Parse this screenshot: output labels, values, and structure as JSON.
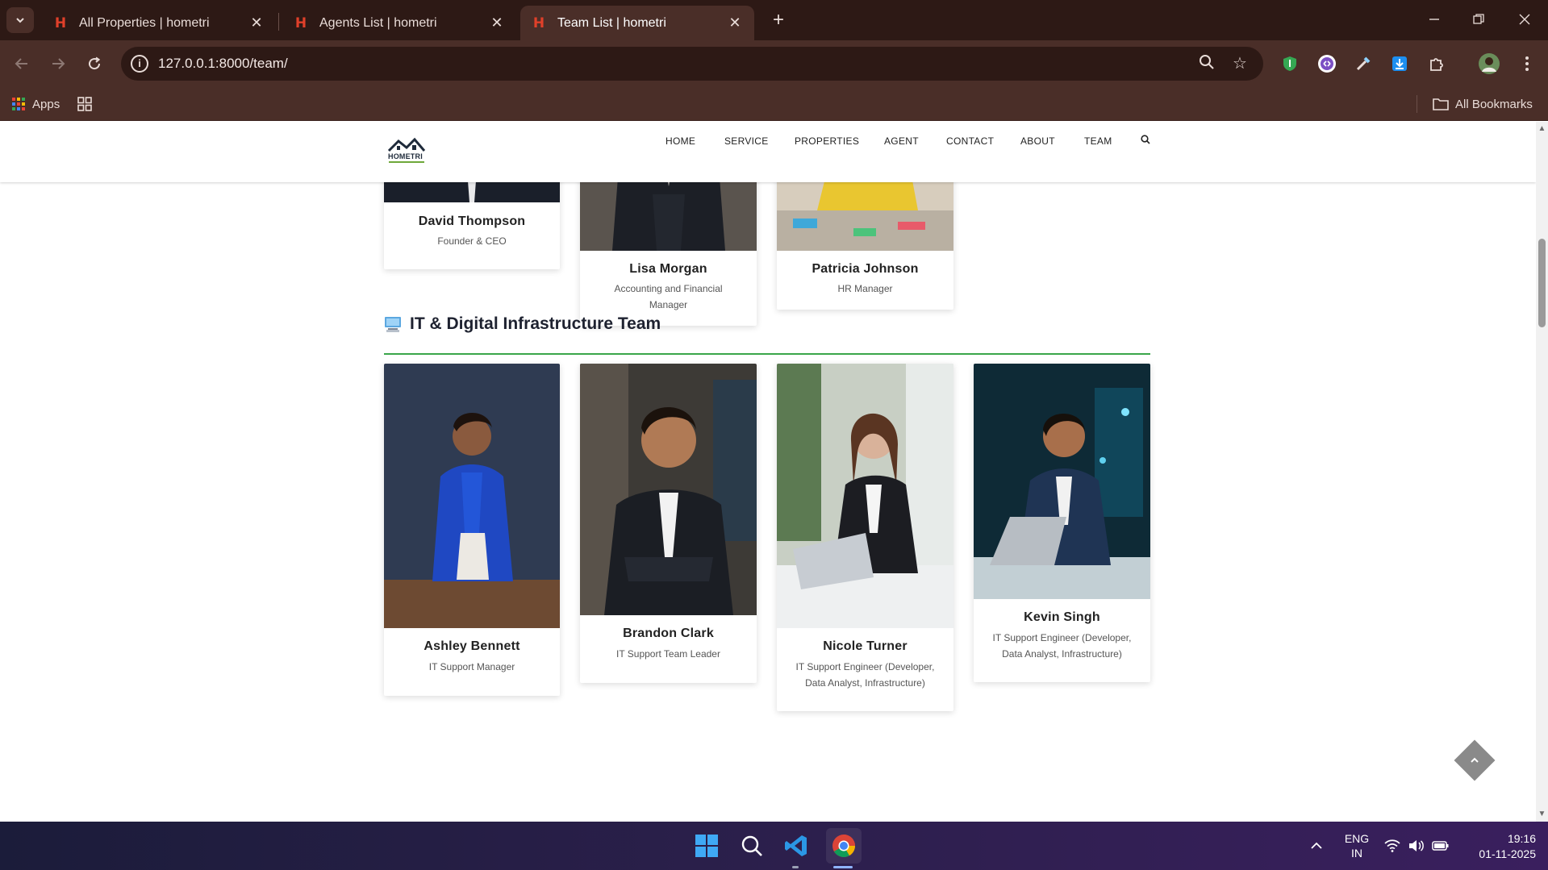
{
  "browser": {
    "tabs": [
      {
        "title": "All Properties | hometri",
        "active": false
      },
      {
        "title": "Agents List | hometri",
        "active": false
      },
      {
        "title": "Team List | hometri",
        "active": true
      }
    ],
    "url": "127.0.0.1:8000/team/",
    "bookmarks": {
      "apps_label": "Apps",
      "all_bookmarks_label": "All Bookmarks"
    }
  },
  "site": {
    "logo_text": "HOMETRI",
    "nav": [
      "HOME",
      "SERVICE",
      "PROPERTIES",
      "AGENT",
      "CONTACT",
      "ABOUT",
      "TEAM"
    ]
  },
  "leadership_row": [
    {
      "name": "David Thompson",
      "role": "Founder & CEO"
    },
    {
      "name": "Lisa Morgan",
      "role": "Accounting and Financial Manager"
    },
    {
      "name": "Patricia Johnson",
      "role": "HR Manager"
    }
  ],
  "it_section": {
    "icon": "computer-icon",
    "title": "IT & Digital Infrastructure Team",
    "rule_color": "#3aa64a",
    "members": [
      {
        "name": "Ashley Bennett",
        "role": "IT Support Manager"
      },
      {
        "name": "Brandon Clark",
        "role": "IT Support Team Leader"
      },
      {
        "name": "Nicole Turner",
        "role": "IT Support Engineer (Developer, Data Analyst, Infrastructure)"
      },
      {
        "name": "Kevin Singh",
        "role": "IT Support Engineer (Developer, Data Analyst, Infrastructure)"
      }
    ]
  },
  "taskbar": {
    "lang_top": "ENG",
    "lang_bottom": "IN",
    "time": "19:16",
    "date": "01-11-2025"
  }
}
